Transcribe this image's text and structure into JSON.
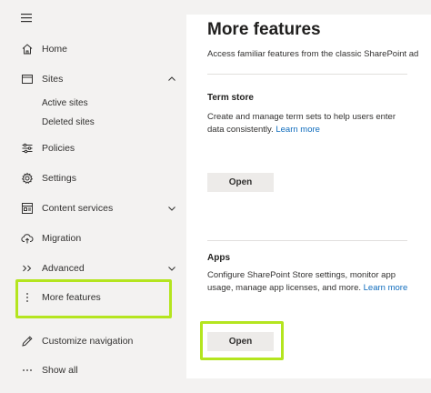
{
  "sidebar": {
    "items": [
      {
        "id": "home",
        "label": "Home",
        "icon": "home-icon"
      },
      {
        "id": "sites",
        "label": "Sites",
        "icon": "sites-icon",
        "expanded": true,
        "children": [
          {
            "label": "Active sites"
          },
          {
            "label": "Deleted sites"
          }
        ]
      },
      {
        "id": "policies",
        "label": "Policies",
        "icon": "policies-icon"
      },
      {
        "id": "settings",
        "label": "Settings",
        "icon": "gear-icon"
      },
      {
        "id": "content-services",
        "label": "Content services",
        "icon": "content-services-icon"
      },
      {
        "id": "migration",
        "label": "Migration",
        "icon": "cloud-upload-icon"
      },
      {
        "id": "advanced",
        "label": "Advanced",
        "icon": "advanced-icon"
      },
      {
        "id": "more-features",
        "label": "More features",
        "icon": "more-vertical-icon",
        "selected": true
      },
      {
        "id": "customize-navigation",
        "label": "Customize navigation",
        "icon": "pencil-icon"
      },
      {
        "id": "show-all",
        "label": "Show all",
        "icon": "more-horizontal-icon"
      }
    ]
  },
  "main": {
    "title": "More features",
    "description": "Access familiar features from the classic SharePoint ad",
    "sections": [
      {
        "title": "Term store",
        "text": "Create and manage term sets to help users enter data consistently.",
        "link": "Learn more",
        "button": "Open"
      },
      {
        "title": "Apps",
        "text": "Configure SharePoint Store settings, monitor app usage, manage app licenses, and more.",
        "link": "Learn more",
        "button": "Open"
      }
    ]
  },
  "colors": {
    "highlight": "#b4e51f",
    "link": "#0f6cbd",
    "sidebar_bg": "#f3f2f1",
    "button_bg": "#edebe9"
  }
}
